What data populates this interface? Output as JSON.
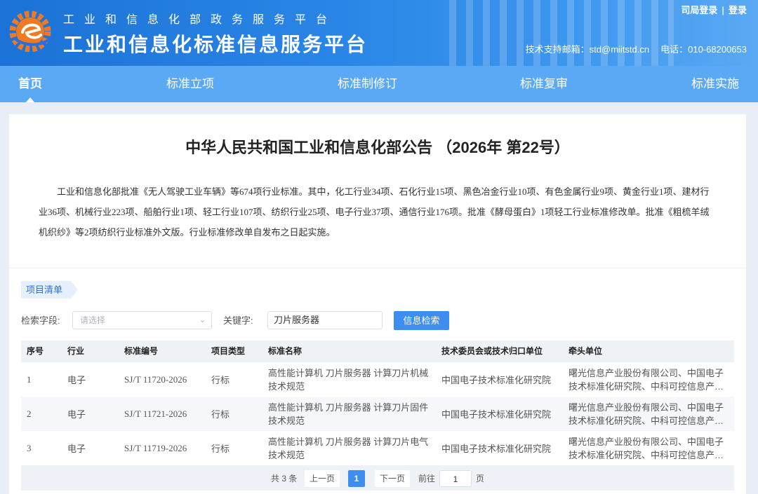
{
  "header": {
    "sub_title": "工业和信息化部政务服务平台",
    "main_title": "工业和信息化标准信息服务平台",
    "links": {
      "bureau_login": "司局登录",
      "separator": "|",
      "login": "登录"
    },
    "contact": {
      "email_label": "技术支持邮箱：",
      "email": "std@miitstd.cn",
      "phone_label": "电话：",
      "phone": "010-68200653"
    }
  },
  "nav": {
    "items": [
      "首页",
      "标准立项",
      "标准制修订",
      "标准复审",
      "标准实施"
    ],
    "active_index": 0
  },
  "notice": {
    "title": "中华人民共和国工业和信息化部公告 （2026年 第22号）",
    "body": "工业和信息化部批准《无人驾驶工业车辆》等674项行业标准。其中，化工行业34项、石化行业15项、黑色冶金行业10项、有色金属行业9项、黄金行业1项、建材行业36项、机械行业223项、船舶行业1项、轻工行业107项、纺织行业25项、电子行业37项、通信行业176项。批准《酵母蛋白》1项轻工行业标准修改单。批准《粗梳羊绒机织纱》等2项纺织行业标准外文版。行业标准修改单自发布之日起实施。"
  },
  "projects": {
    "tag": "项目清单",
    "filter": {
      "field_label": "检索字段:",
      "field_placeholder": "请选择",
      "keyword_label": "关键字:",
      "keyword_value": "刀片服务器",
      "search_button": "信息检索"
    },
    "columns": [
      "序号",
      "行业",
      "标准编号",
      "项目类型",
      "标准名称",
      "技术委员会或技术归口单位",
      "牵头单位"
    ],
    "rows": [
      {
        "no": "1",
        "industry": "电子",
        "code": "SJ/T 11720-2026",
        "type": "行标",
        "name_l1": "高性能计算机 刀片服务器 计算刀片机械",
        "name_l2": "技术规范",
        "committee": "中国电子技术标准化研究院",
        "lead_l1": "曙光信息产业股份有限公司、中国电子",
        "lead_l2": "技术标准化研究院、中科可控信息产…"
      },
      {
        "no": "2",
        "industry": "电子",
        "code": "SJ/T 11721-2026",
        "type": "行标",
        "name_l1": "高性能计算机 刀片服务器 计算刀片固件",
        "name_l2": "技术规范",
        "committee": "中国电子技术标准化研究院",
        "lead_l1": "曙光信息产业股份有限公司、中国电子",
        "lead_l2": "技术标准化研究院、中科可控信息产…"
      },
      {
        "no": "3",
        "industry": "电子",
        "code": "SJ/T 11719-2026",
        "type": "行标",
        "name_l1": "高性能计算机 刀片服务器 计算刀片电气",
        "name_l2": "技术规范",
        "committee": "中国电子技术标准化研究院",
        "lead_l1": "曙光信息产业股份有限公司、中国电子",
        "lead_l2": "技术标准化研究院、中科可控信息产…"
      }
    ],
    "pagination": {
      "total": "共 3 条",
      "prev": "上一页",
      "current": "1",
      "next": "下一页",
      "goto_label": "前往",
      "goto_value": "1",
      "page_unit": "页"
    }
  },
  "colors": {
    "header_blue": "#2a86e6",
    "nav_blue": "#5aa9f4",
    "accent": "#3d8ef0",
    "logo_orange": "#f07a22"
  },
  "icons": [
    "site-logo-icon",
    "chevron-down-icon"
  ]
}
